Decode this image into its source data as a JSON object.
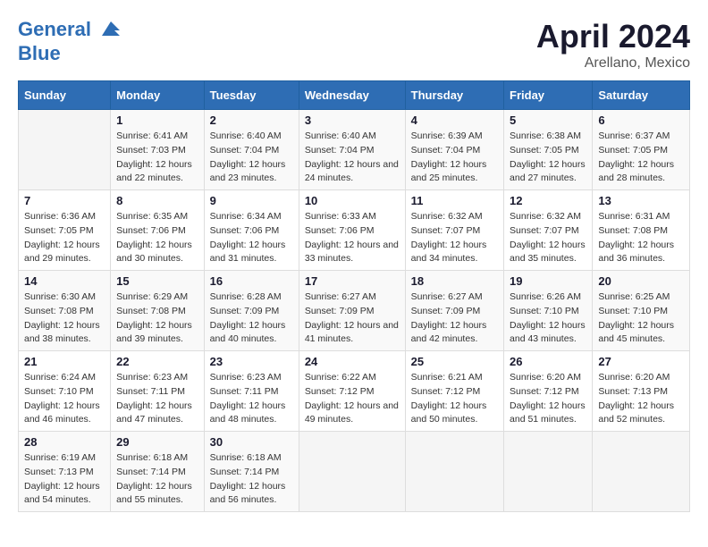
{
  "header": {
    "logo_line1": "General",
    "logo_line2": "Blue",
    "title": "April 2024",
    "subtitle": "Arellano, Mexico"
  },
  "days_of_week": [
    "Sunday",
    "Monday",
    "Tuesday",
    "Wednesday",
    "Thursday",
    "Friday",
    "Saturday"
  ],
  "weeks": [
    [
      {
        "day": "",
        "empty": true
      },
      {
        "day": "1",
        "sunrise": "Sunrise: 6:41 AM",
        "sunset": "Sunset: 7:03 PM",
        "daylight": "Daylight: 12 hours and 22 minutes."
      },
      {
        "day": "2",
        "sunrise": "Sunrise: 6:40 AM",
        "sunset": "Sunset: 7:04 PM",
        "daylight": "Daylight: 12 hours and 23 minutes."
      },
      {
        "day": "3",
        "sunrise": "Sunrise: 6:40 AM",
        "sunset": "Sunset: 7:04 PM",
        "daylight": "Daylight: 12 hours and 24 minutes."
      },
      {
        "day": "4",
        "sunrise": "Sunrise: 6:39 AM",
        "sunset": "Sunset: 7:04 PM",
        "daylight": "Daylight: 12 hours and 25 minutes."
      },
      {
        "day": "5",
        "sunrise": "Sunrise: 6:38 AM",
        "sunset": "Sunset: 7:05 PM",
        "daylight": "Daylight: 12 hours and 27 minutes."
      },
      {
        "day": "6",
        "sunrise": "Sunrise: 6:37 AM",
        "sunset": "Sunset: 7:05 PM",
        "daylight": "Daylight: 12 hours and 28 minutes."
      }
    ],
    [
      {
        "day": "7",
        "sunrise": "Sunrise: 6:36 AM",
        "sunset": "Sunset: 7:05 PM",
        "daylight": "Daylight: 12 hours and 29 minutes."
      },
      {
        "day": "8",
        "sunrise": "Sunrise: 6:35 AM",
        "sunset": "Sunset: 7:06 PM",
        "daylight": "Daylight: 12 hours and 30 minutes."
      },
      {
        "day": "9",
        "sunrise": "Sunrise: 6:34 AM",
        "sunset": "Sunset: 7:06 PM",
        "daylight": "Daylight: 12 hours and 31 minutes."
      },
      {
        "day": "10",
        "sunrise": "Sunrise: 6:33 AM",
        "sunset": "Sunset: 7:06 PM",
        "daylight": "Daylight: 12 hours and 33 minutes."
      },
      {
        "day": "11",
        "sunrise": "Sunrise: 6:32 AM",
        "sunset": "Sunset: 7:07 PM",
        "daylight": "Daylight: 12 hours and 34 minutes."
      },
      {
        "day": "12",
        "sunrise": "Sunrise: 6:32 AM",
        "sunset": "Sunset: 7:07 PM",
        "daylight": "Daylight: 12 hours and 35 minutes."
      },
      {
        "day": "13",
        "sunrise": "Sunrise: 6:31 AM",
        "sunset": "Sunset: 7:08 PM",
        "daylight": "Daylight: 12 hours and 36 minutes."
      }
    ],
    [
      {
        "day": "14",
        "sunrise": "Sunrise: 6:30 AM",
        "sunset": "Sunset: 7:08 PM",
        "daylight": "Daylight: 12 hours and 38 minutes."
      },
      {
        "day": "15",
        "sunrise": "Sunrise: 6:29 AM",
        "sunset": "Sunset: 7:08 PM",
        "daylight": "Daylight: 12 hours and 39 minutes."
      },
      {
        "day": "16",
        "sunrise": "Sunrise: 6:28 AM",
        "sunset": "Sunset: 7:09 PM",
        "daylight": "Daylight: 12 hours and 40 minutes."
      },
      {
        "day": "17",
        "sunrise": "Sunrise: 6:27 AM",
        "sunset": "Sunset: 7:09 PM",
        "daylight": "Daylight: 12 hours and 41 minutes."
      },
      {
        "day": "18",
        "sunrise": "Sunrise: 6:27 AM",
        "sunset": "Sunset: 7:09 PM",
        "daylight": "Daylight: 12 hours and 42 minutes."
      },
      {
        "day": "19",
        "sunrise": "Sunrise: 6:26 AM",
        "sunset": "Sunset: 7:10 PM",
        "daylight": "Daylight: 12 hours and 43 minutes."
      },
      {
        "day": "20",
        "sunrise": "Sunrise: 6:25 AM",
        "sunset": "Sunset: 7:10 PM",
        "daylight": "Daylight: 12 hours and 45 minutes."
      }
    ],
    [
      {
        "day": "21",
        "sunrise": "Sunrise: 6:24 AM",
        "sunset": "Sunset: 7:10 PM",
        "daylight": "Daylight: 12 hours and 46 minutes."
      },
      {
        "day": "22",
        "sunrise": "Sunrise: 6:23 AM",
        "sunset": "Sunset: 7:11 PM",
        "daylight": "Daylight: 12 hours and 47 minutes."
      },
      {
        "day": "23",
        "sunrise": "Sunrise: 6:23 AM",
        "sunset": "Sunset: 7:11 PM",
        "daylight": "Daylight: 12 hours and 48 minutes."
      },
      {
        "day": "24",
        "sunrise": "Sunrise: 6:22 AM",
        "sunset": "Sunset: 7:12 PM",
        "daylight": "Daylight: 12 hours and 49 minutes."
      },
      {
        "day": "25",
        "sunrise": "Sunrise: 6:21 AM",
        "sunset": "Sunset: 7:12 PM",
        "daylight": "Daylight: 12 hours and 50 minutes."
      },
      {
        "day": "26",
        "sunrise": "Sunrise: 6:20 AM",
        "sunset": "Sunset: 7:12 PM",
        "daylight": "Daylight: 12 hours and 51 minutes."
      },
      {
        "day": "27",
        "sunrise": "Sunrise: 6:20 AM",
        "sunset": "Sunset: 7:13 PM",
        "daylight": "Daylight: 12 hours and 52 minutes."
      }
    ],
    [
      {
        "day": "28",
        "sunrise": "Sunrise: 6:19 AM",
        "sunset": "Sunset: 7:13 PM",
        "daylight": "Daylight: 12 hours and 54 minutes."
      },
      {
        "day": "29",
        "sunrise": "Sunrise: 6:18 AM",
        "sunset": "Sunset: 7:14 PM",
        "daylight": "Daylight: 12 hours and 55 minutes."
      },
      {
        "day": "30",
        "sunrise": "Sunrise: 6:18 AM",
        "sunset": "Sunset: 7:14 PM",
        "daylight": "Daylight: 12 hours and 56 minutes."
      },
      {
        "day": "",
        "empty": true
      },
      {
        "day": "",
        "empty": true
      },
      {
        "day": "",
        "empty": true
      },
      {
        "day": "",
        "empty": true
      }
    ]
  ]
}
